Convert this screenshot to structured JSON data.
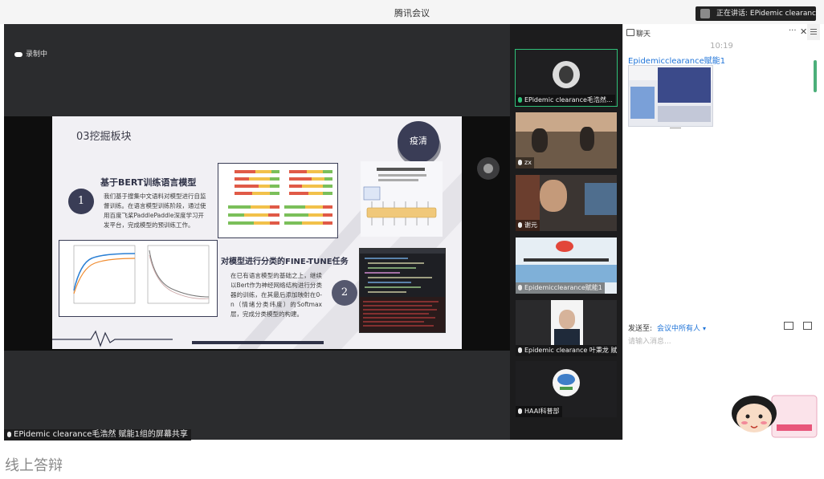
{
  "window": {
    "title": "腾讯会议"
  },
  "speaking_indicator": {
    "text": "正在讲话: EPidemic clearance..."
  },
  "recording": {
    "label": "录制中"
  },
  "share": {
    "footer_label": "EPidemic clearance毛浩然 赋能1组的屏幕共享"
  },
  "slide": {
    "title": "03挖掘板块",
    "logo_text": "疫清",
    "section1": {
      "number": "1",
      "title": "基于BERT训练语言模型",
      "body": "我们基于搜集中文语料对模型进行自监督训练。在语言模型训练阶段，通过使用百度飞桨PaddlePaddle深度学习开发平台，完成模型的预训练工作。"
    },
    "section2": {
      "number": "2",
      "title": "对模型进行分类的FINE-TUNE任务",
      "body": "在已有语言模型的基础之上，继续以Bert作为神经网络结构进行分类器的训练，在其最后添加映射在0-n（情绪分类纬度）的Softmax层，完成分类模型的构建。"
    }
  },
  "participants": [
    {
      "name": "EPidemic clearance毛浩然...",
      "active": true
    },
    {
      "name": "zx",
      "active": false
    },
    {
      "name": "谢元",
      "active": false
    },
    {
      "name": "Epidemicclearance赋能1",
      "active": false
    },
    {
      "name": "Epidemic clearance 叶秉龙 赋能...",
      "active": false
    },
    {
      "name": "HAAI科普部",
      "active": false
    }
  ],
  "chat": {
    "title": "聊天",
    "more_icon": "···",
    "close_icon": "✕",
    "time": "10:19",
    "sender": "Epidemicclearance赋能1",
    "send_to_label": "发送至:",
    "send_to_target": "会议中所有人",
    "input_placeholder": "请输入消息..."
  },
  "caption": "线上答辩",
  "colors": {
    "accent_green": "#2fc179",
    "link_blue": "#1e73d8",
    "slide_navy": "#3a3d56"
  }
}
